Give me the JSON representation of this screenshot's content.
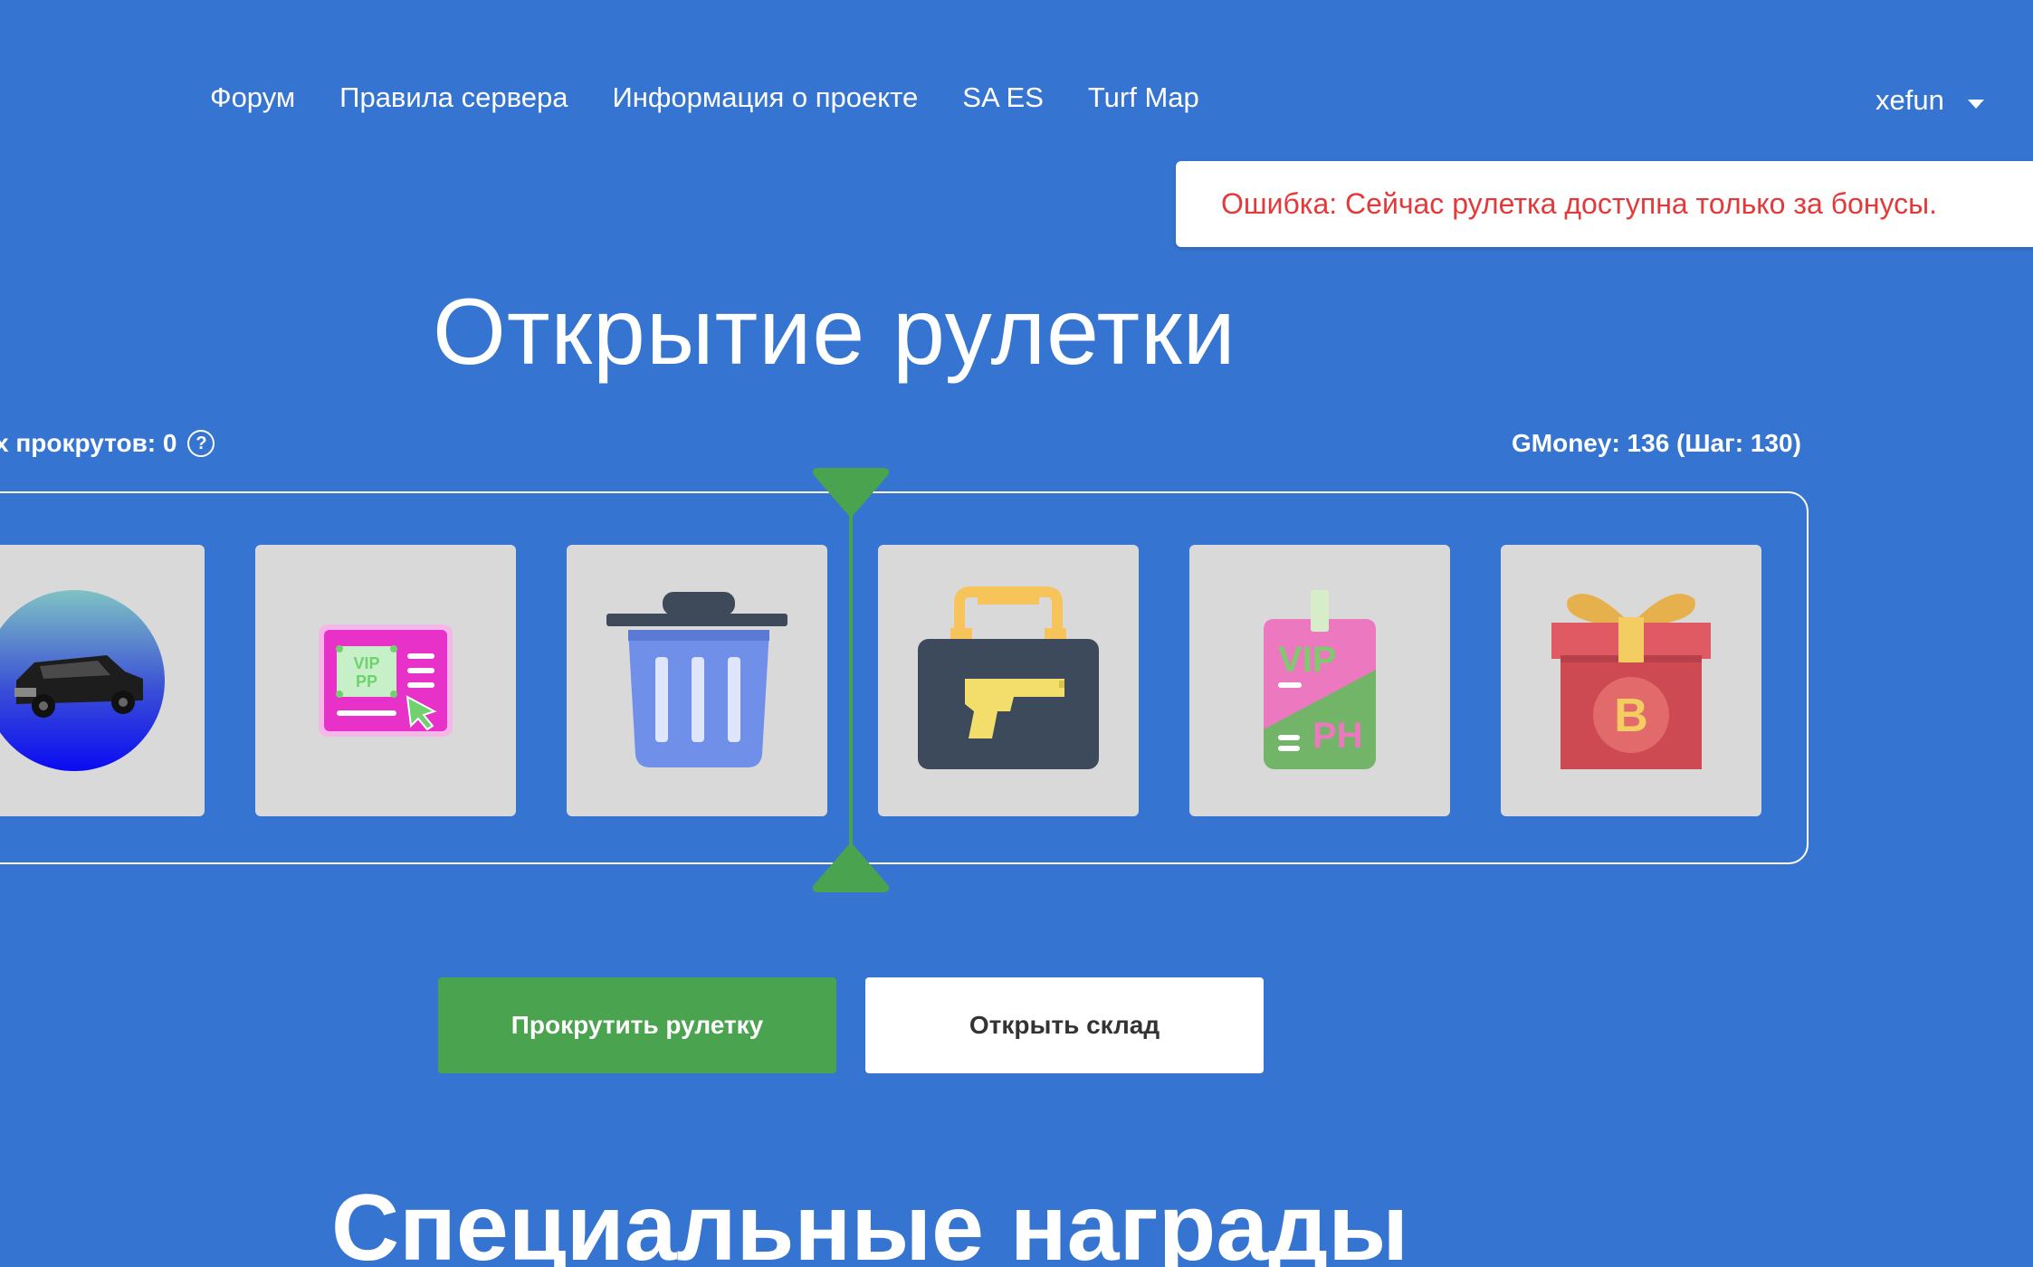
{
  "nav": {
    "items": [
      {
        "label": "Форум"
      },
      {
        "label": "Правила сервера"
      },
      {
        "label": "Информация о проекте"
      },
      {
        "label": "SA ES"
      },
      {
        "label": "Turf Map"
      }
    ],
    "user": "xefun"
  },
  "toast": {
    "message": "Ошибка: Сейчас рулетка доступна только за бонусы."
  },
  "main": {
    "title": "Открытие рулетки",
    "spins_label": "х прокрутов: 0",
    "help_glyph": "?",
    "gmoney": "GMoney: 136 (Шаг: 130)",
    "slots": [
      {
        "icon": "car-icon"
      },
      {
        "icon": "vip-pp-card-icon",
        "text_line1": "VIP",
        "text_line2": "PP"
      },
      {
        "icon": "trash-can-icon"
      },
      {
        "icon": "gun-case-icon"
      },
      {
        "icon": "vip-ph-badge-icon",
        "text_top": "VIP",
        "text_bottom": "PH"
      },
      {
        "icon": "bonus-gift-icon",
        "text": "B"
      }
    ],
    "buttons": {
      "spin": "Прокрутить рулетку",
      "storage": "Открыть склад"
    },
    "special_title": "Специальные награды"
  },
  "colors": {
    "background": "#3575d1",
    "accent_green": "#4aa34e",
    "error_red": "#e4393a",
    "slot_bg": "#d9d9d9"
  }
}
